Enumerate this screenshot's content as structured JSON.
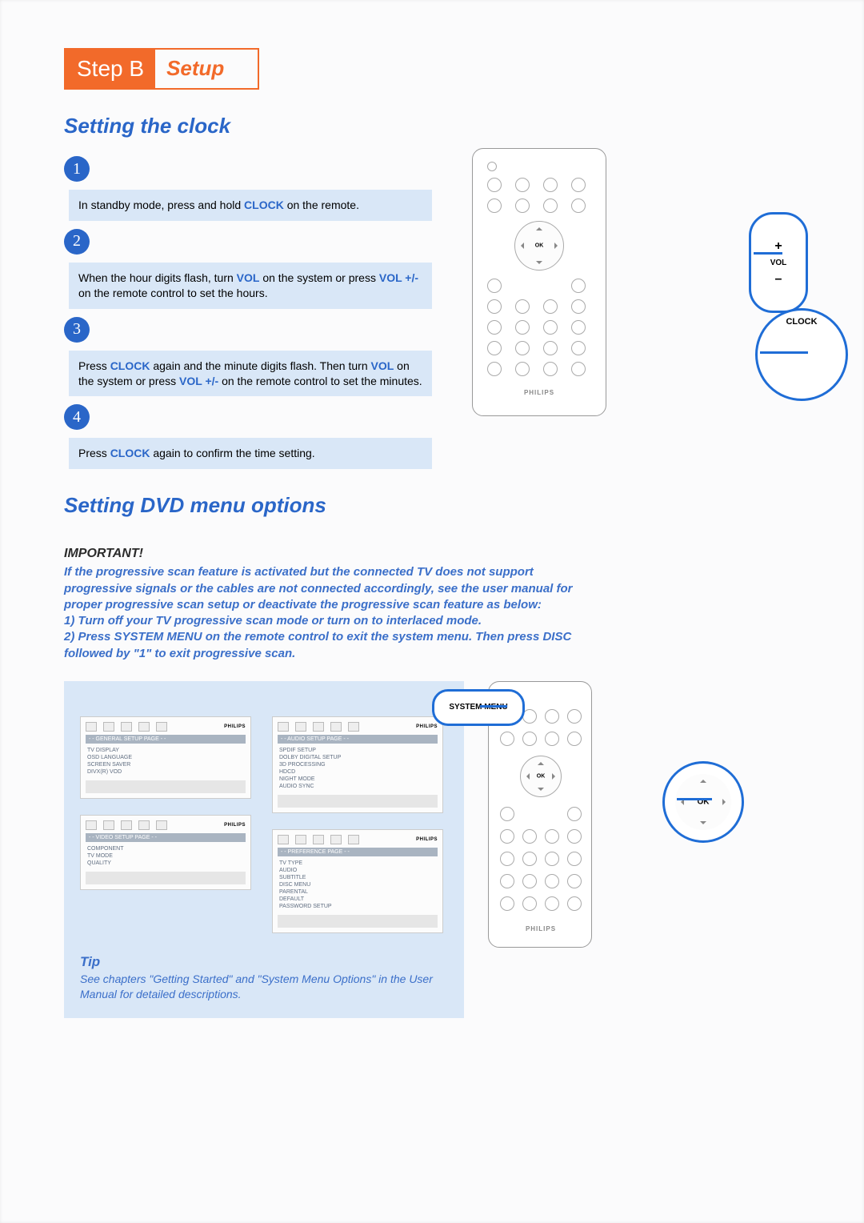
{
  "step_header": {
    "label": "Step B",
    "sub": "Setup"
  },
  "section1_title": "Setting the clock",
  "clock_steps": [
    {
      "n": "1",
      "pre": "In standby mode, press and hold ",
      "kw": "CLOCK",
      "post": " on the remote."
    },
    {
      "n": "2",
      "pre": "When the hour digits flash, turn ",
      "kw": "VOL",
      "mid": " on the system or press ",
      "kw2": "VOL +/-",
      "post": " on the remote control to set the hours."
    },
    {
      "n": "3",
      "pre": "Press ",
      "kw": "CLOCK",
      "mid": " again and the minute digits flash. Then turn ",
      "kw2": "VOL",
      "mid2": " on the system or press ",
      "kw3": "VOL +/-",
      "post": " on the remote control to set the minutes."
    },
    {
      "n": "4",
      "pre": "Press ",
      "kw": "CLOCK",
      "post": " again to confirm the time setting."
    }
  ],
  "callouts": {
    "vol": {
      "plus": "+",
      "label": "VOL",
      "minus": "–"
    },
    "clock": "CLOCK",
    "system_menu": "SYSTEM MENU",
    "ok": "OK"
  },
  "section2_title": "Setting DVD menu options",
  "important": {
    "title": "IMPORTANT!",
    "body": "If the progressive scan feature is activated but the connected TV does not support progressive signals or the cables are not connected accordingly, see the user manual for proper progressive scan setup or deactivate the progressive scan feature as below:\n1) Turn off your TV progressive scan mode or turn on to interlaced mode.\n2) Press SYSTEM MENU on the remote control to exit the system menu. Then press DISC followed by \"1\" to exit progressive scan."
  },
  "menu_brand": "PHILIPS",
  "menus": {
    "general": {
      "title": "- - GENERAL SETUP PAGE - -",
      "items": [
        "TV DISPLAY",
        "OSD LANGUAGE",
        "SCREEN SAVER",
        "DIVX(R) VOD"
      ]
    },
    "audio": {
      "title": "- - AUDIO SETUP PAGE - -",
      "items": [
        "SPDIF SETUP",
        "DOLBY DIGITAL SETUP",
        "3D PROCESSING",
        "HDCD",
        "NIGHT MODE",
        "AUDIO SYNC"
      ]
    },
    "video": {
      "title": "- - VIDEO SETUP PAGE - -",
      "items": [
        "COMPONENT",
        "TV MODE",
        "QUALITY"
      ]
    },
    "pref": {
      "title": "- - PREFERENCE PAGE - -",
      "items": [
        "TV TYPE",
        "AUDIO",
        "SUBTITLE",
        "DISC MENU",
        "PARENTAL",
        "DEFAULT",
        "PASSWORD SETUP"
      ]
    }
  },
  "tip": {
    "title": "Tip",
    "body": "See chapters \"Getting Started\" and \"System Menu Options\" in the User Manual for detailed descriptions."
  },
  "brand": "PHILIPS"
}
